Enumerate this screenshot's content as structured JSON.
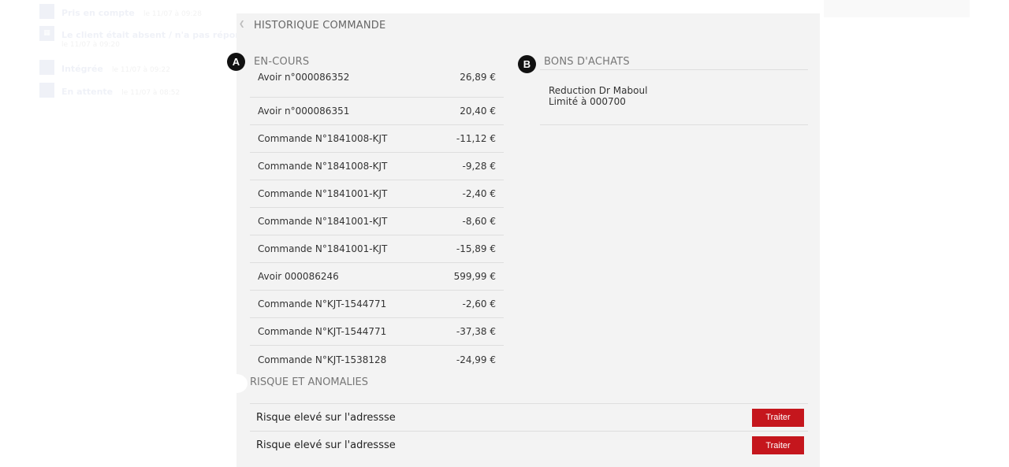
{
  "background_list": [
    {
      "icon": "square-icon",
      "title": "Pris en compte",
      "sub": "le 11/07 à 09:28",
      "sub2": ""
    },
    {
      "icon": "grid-icon",
      "title": "Le client était absent / n'a pas répondu",
      "sub": "",
      "sub2": "le 11/07 à 09:20"
    },
    {
      "icon": "square-icon",
      "title": "Intégrée",
      "sub": "le 11/07 à 09:22",
      "sub2": ""
    },
    {
      "icon": "square-icon",
      "title": "En attente",
      "sub": "le 11/07 à 08:52",
      "sub2": ""
    }
  ],
  "panel": {
    "title": "HISTORIQUE COMMANDE",
    "en_cours": {
      "marker": "A",
      "label": "EN-COURS",
      "rows": [
        {
          "label": "Avoir n°000086352",
          "amount": "26,89 €"
        },
        {
          "label": "Avoir n°000086351",
          "amount": "20,40 €"
        },
        {
          "label": "Commande N°1841008-KJT",
          "amount": "-11,12 €"
        },
        {
          "label": "Commande N°1841008-KJT",
          "amount": "-9,28 €"
        },
        {
          "label": "Commande N°1841001-KJT",
          "amount": "-2,40 €"
        },
        {
          "label": "Commande N°1841001-KJT",
          "amount": "-8,60 €"
        },
        {
          "label": "Commande N°1841001-KJT",
          "amount": "-15,89 €"
        },
        {
          "label": "Avoir 000086246",
          "amount": "599,99 €"
        },
        {
          "label": "Commande N°KJT-1544771",
          "amount": "-2,60 €"
        },
        {
          "label": "Commande N°KJT-1544771",
          "amount": "-37,38 €"
        },
        {
          "label": "Commande N°KJT-1538128",
          "amount": "-24,99 €"
        }
      ]
    },
    "bons_achats": {
      "marker": "B",
      "label": "BONS D'ACHATS",
      "item_line1": "Reduction Dr Maboul",
      "item_line2": "Limité à 000700"
    },
    "risques": {
      "label": "RISQUE ET ANOMALIES",
      "rows": [
        {
          "label": "Risque elevé sur l'adressse",
          "button": "Traiter"
        },
        {
          "label": "Risque elevé sur l'adressse",
          "button": "Traiter"
        }
      ]
    }
  },
  "colors": {
    "panel_bg": "#f3f3f3",
    "accent_button": "#c5161d",
    "marker": "#111111",
    "divider": "#dedede"
  }
}
